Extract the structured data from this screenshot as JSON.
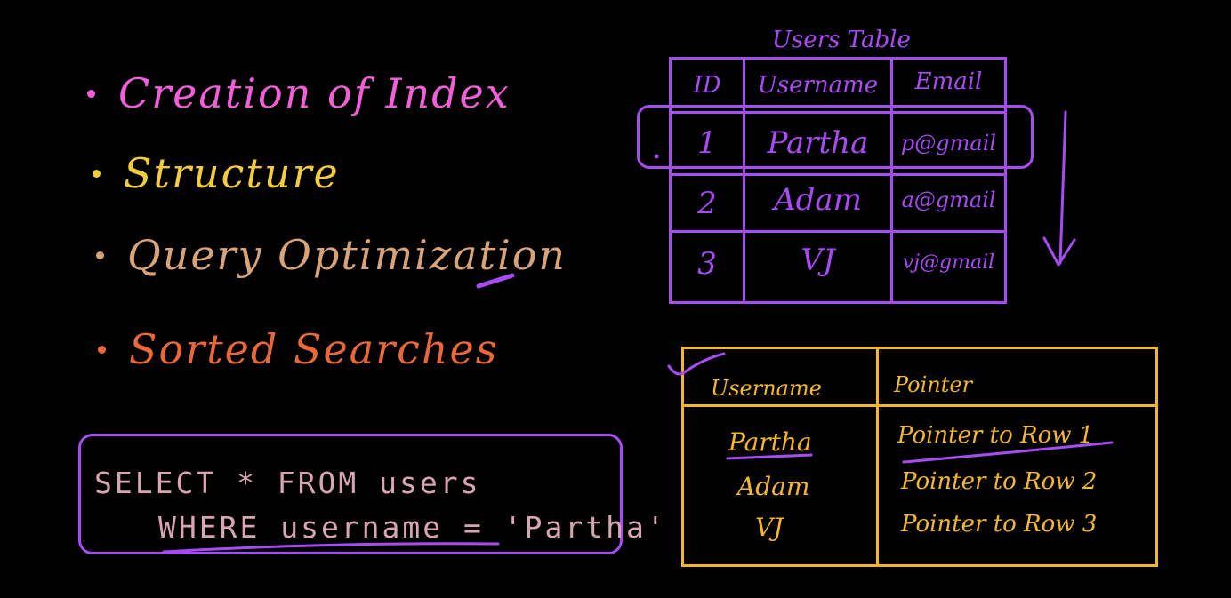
{
  "bullets": [
    {
      "text": "Creation of Index",
      "color": "#f25fd9"
    },
    {
      "text": "Structure",
      "color": "#f4cc3d"
    },
    {
      "text": "Query Optimization",
      "color": "#d9a37a"
    },
    {
      "text": "Sorted Searches",
      "color": "#e8683a"
    }
  ],
  "sql": {
    "line1": "SELECT * FROM users",
    "line2": "WHERE username = 'Partha'"
  },
  "users_table": {
    "title": "Users Table",
    "headers": [
      "ID",
      "Username",
      "Email"
    ],
    "rows": [
      [
        "1",
        "Partha",
        "p@gmail"
      ],
      [
        "2",
        "Adam",
        "a@gmail"
      ],
      [
        "3",
        "VJ",
        "vj@gmail"
      ]
    ]
  },
  "index_table": {
    "headers": [
      "Username",
      "Pointer"
    ],
    "rows": [
      [
        "Partha",
        "Pointer to Row 1"
      ],
      [
        "Adam",
        "Pointer to Row 2"
      ],
      [
        "VJ",
        "Pointer to Row 3"
      ]
    ]
  },
  "colors": {
    "purple": "#a64cf2",
    "yellow": "#f4b62c",
    "sql_text": "#d8a6b0"
  }
}
